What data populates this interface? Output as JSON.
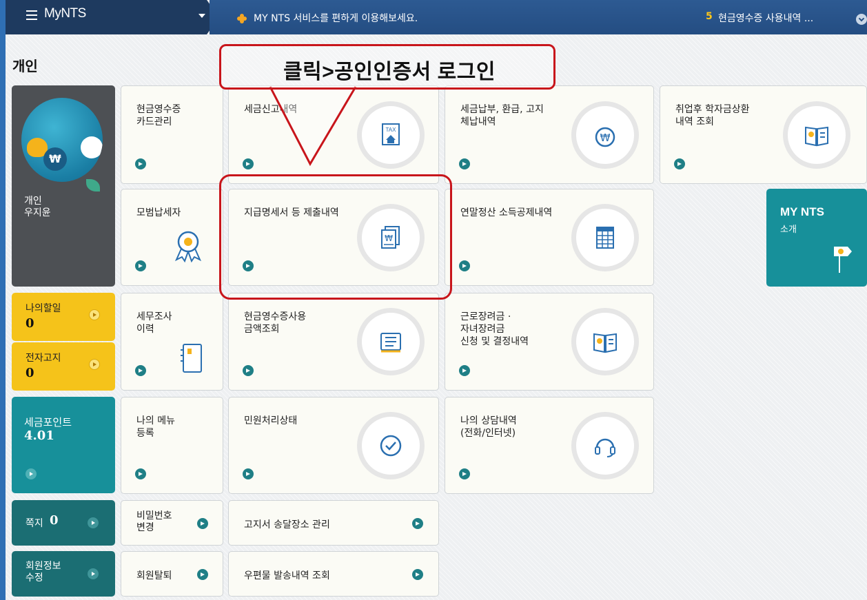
{
  "topbar": {
    "logo": "MyNTS",
    "message": "MY NTS 서비스를 편하게 이용해보세요.",
    "notice_count": "5",
    "notice_text": "현금영수증 사용내역 ..."
  },
  "section_title": "개인",
  "profile": {
    "role": "개인",
    "name": "우지윤"
  },
  "annotation": {
    "callout": "클릭>공인인증서 로그인"
  },
  "tiles": [
    {
      "label": "현금영수증\n카드관리",
      "icon": "card-icon"
    },
    {
      "label": "세금신고내역",
      "icon": "tax-house-icon",
      "icon_text": "TAX"
    },
    {
      "label": "세금납부, 환급, 고지\n체납내역",
      "icon": "won-coin-icon"
    },
    {
      "label": "취업후 학자금상환\n내역 조회",
      "icon": "open-book-icon"
    },
    {
      "label": "모범납세자",
      "icon": "award-ribbon-icon"
    },
    {
      "label": "지급명세서 등 제출내역",
      "icon": "won-document-icon"
    },
    {
      "label": "연말정산 소득공제내역",
      "icon": "spreadsheet-icon"
    },
    {
      "label": "세무조사\n이력",
      "icon": "notebook-icon"
    },
    {
      "label": "현금영수증사용\n금액조회",
      "icon": "receipt-list-icon"
    },
    {
      "label": "근로장려금 ·\n자녀장려금\n신청 및 결정내역",
      "icon": "open-book-icon"
    },
    {
      "label": "나의 메뉴\n등록",
      "icon": ""
    },
    {
      "label": "민원처리상태",
      "icon": "check-circle-icon"
    },
    {
      "label": "나의 상담내역\n(전화/인터넷)",
      "icon": "headset-icon"
    }
  ],
  "todo": {
    "label": "나의할일",
    "value": "0"
  },
  "e_notice": {
    "label": "전자고지",
    "value": "0"
  },
  "tax_points": {
    "label": "세금포인트",
    "value": "4.01"
  },
  "messages": {
    "label": "쪽지",
    "value": "0"
  },
  "member_edit": {
    "label": "회원정보\n수정"
  },
  "my_nts": {
    "title": "MY NTS",
    "subtitle": "소개"
  },
  "small_links": {
    "password": "비밀번호\n변경",
    "bill_address": "고지서 송달장소 관리",
    "withdraw": "회원탈퇴",
    "mail_history": "우편물 발송내역 조회"
  },
  "colors": {
    "accent_teal": "#17909a",
    "accent_yellow": "#f5c31a",
    "annotation_red": "#c8151b",
    "topbar": "#244d82"
  }
}
